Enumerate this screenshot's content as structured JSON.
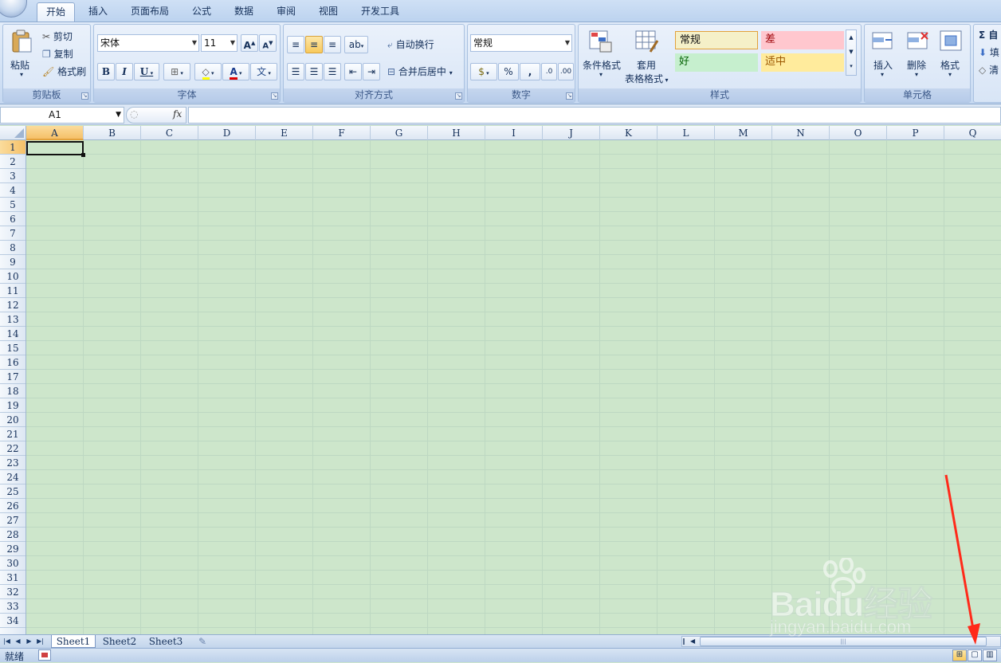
{
  "ribbon_tabs": [
    "开始",
    "插入",
    "页面布局",
    "公式",
    "数据",
    "审阅",
    "视图",
    "开发工具"
  ],
  "active_tab": "开始",
  "clipboard": {
    "paste": "粘贴",
    "cut": "剪切",
    "copy": "复制",
    "format_painter": "格式刷",
    "label": "剪贴板"
  },
  "font": {
    "name": "宋体",
    "size": "11",
    "grow": "A",
    "shrink": "A",
    "bold": "B",
    "italic": "I",
    "underline": "U",
    "label": "字体"
  },
  "alignment": {
    "wrap_text": "自动换行",
    "merge_center": "合并后居中",
    "label": "对齐方式"
  },
  "number": {
    "format": "常规",
    "percent": "%",
    "comma": ",",
    "label": "数字"
  },
  "styles": {
    "conditional_format": "条件格式",
    "table_format_line1": "套用",
    "table_format_line2": "表格格式",
    "cells": [
      {
        "text": "常规",
        "bg": "#f5f0c8",
        "fg": "#111111"
      },
      {
        "text": "差",
        "bg": "#ffc7ce",
        "fg": "#9c0006"
      },
      {
        "text": "好",
        "bg": "#c6efce",
        "fg": "#006100"
      },
      {
        "text": "适中",
        "bg": "#ffeb9c",
        "fg": "#9c5700"
      }
    ],
    "label": "样式"
  },
  "cells_group": {
    "insert": "插入",
    "delete": "删除",
    "format": "格式",
    "label": "单元格"
  },
  "editing": {
    "sum": "Σ 自",
    "fill": "填",
    "clear": "清"
  },
  "formula_bar": {
    "name_box": "A1",
    "fx": "fx",
    "content": ""
  },
  "columns": [
    "A",
    "B",
    "C",
    "D",
    "E",
    "F",
    "G",
    "H",
    "I",
    "J",
    "K",
    "L",
    "M",
    "N",
    "O",
    "P",
    "Q"
  ],
  "rows": [
    "1",
    "2",
    "3",
    "4",
    "5",
    "6",
    "7",
    "8",
    "9",
    "10",
    "11",
    "12",
    "13",
    "14",
    "15",
    "16",
    "17",
    "18",
    "19",
    "20",
    "21",
    "22",
    "23",
    "24",
    "25",
    "26",
    "27",
    "28",
    "29",
    "30",
    "31",
    "32",
    "33",
    "34"
  ],
  "sheets": [
    "Sheet1",
    "Sheet2",
    "Sheet3"
  ],
  "active_sheet": "Sheet1",
  "status": {
    "ready": "就绪"
  },
  "watermark": {
    "brand": "Baidu经验",
    "url": "jingyan.baidu.com"
  },
  "colors": {
    "grid_bg": "#cde6cb",
    "annotation_arrow": "#ff2a1a",
    "selection": "#f5c068"
  }
}
